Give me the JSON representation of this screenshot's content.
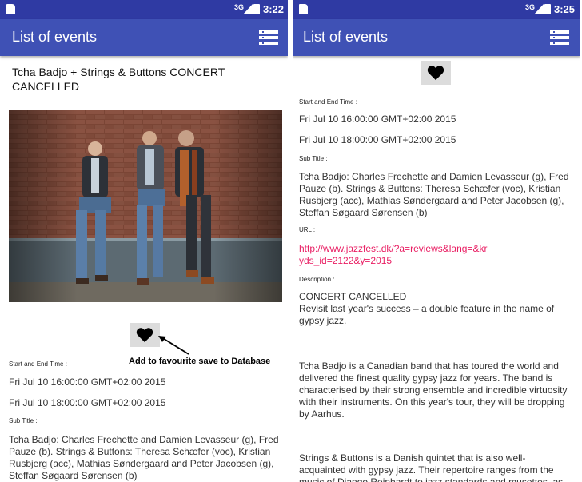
{
  "left": {
    "status": {
      "network": "3G",
      "time": "3:22"
    },
    "appbar": {
      "title": "List of events"
    },
    "event": {
      "title": "Tcha Badjo + Strings & Buttons CONCERT CANCELLED",
      "start_end_label": "Start and End Time :",
      "start_time": "Fri Jul 10 16:00:00 GMT+02:00 2015",
      "end_time": "Fri Jul 10 18:00:00 GMT+02:00 2015",
      "subtitle_label": "Sub Title :",
      "subtitle": "Tcha Badjo: Charles Frechette and Damien Levasseur (g), Fred Pauze (b). Strings & Buttons: Theresa Schæfer (voc), Kristian Rusbjerg (acc), Mathias Søndergaard and Peter Jacobsen (g), Steffan Søgaard Sørensen (b)"
    },
    "annotation": "Add to favourite save to Database"
  },
  "right": {
    "status": {
      "network": "3G",
      "time": "3:25"
    },
    "appbar": {
      "title": "List of events"
    },
    "event": {
      "start_end_label": "Start and End Time :",
      "start_time": "Fri Jul 10 16:00:00 GMT+02:00 2015",
      "end_time": "Fri Jul 10 18:00:00 GMT+02:00 2015",
      "subtitle_label": "Sub Title :",
      "subtitle": "Tcha Badjo: Charles Frechette and Damien Levasseur (g), Fred Pauze (b). Strings & Buttons: Theresa Schæfer (voc), Kristian Rusbjerg (acc), Mathias Søndergaard and Peter Jacobsen (g), Steffan Søgaard Sørensen (b)",
      "url_label": "URL :",
      "url": "http://www.jazzfest.dk/?a=reviews&lang=&kryds_id=2122&y=2015",
      "description_label": "Description :",
      "description_status": "CONCERT CANCELLED",
      "description_p1": "Revisit last year's success – a double feature in the name of gypsy jazz.",
      "description_p2": "Tcha Badjo is a Canadian band that has toured the world and delivered the finest quality gypsy jazz for years. The band is characterised by their strong ensemble and incredible virtuosity with their instruments. On this year's tour, they will be dropping by Aarhus.",
      "description_p3": "Strings & Buttons is a Danish quintet that is also well-acquainted with gypsy jazz. Their repertoire ranges from the music of Django Reinhardt to jazz standards and musettes, as well as"
    }
  },
  "colors": {
    "statusbar": "#2f3aa3",
    "appbar": "#3f51b5",
    "link": "#e91e63"
  },
  "icons": [
    "sd-card-icon",
    "signal-icon",
    "battery-icon",
    "menu-list-icon",
    "heart-icon",
    "arrow-icon"
  ]
}
